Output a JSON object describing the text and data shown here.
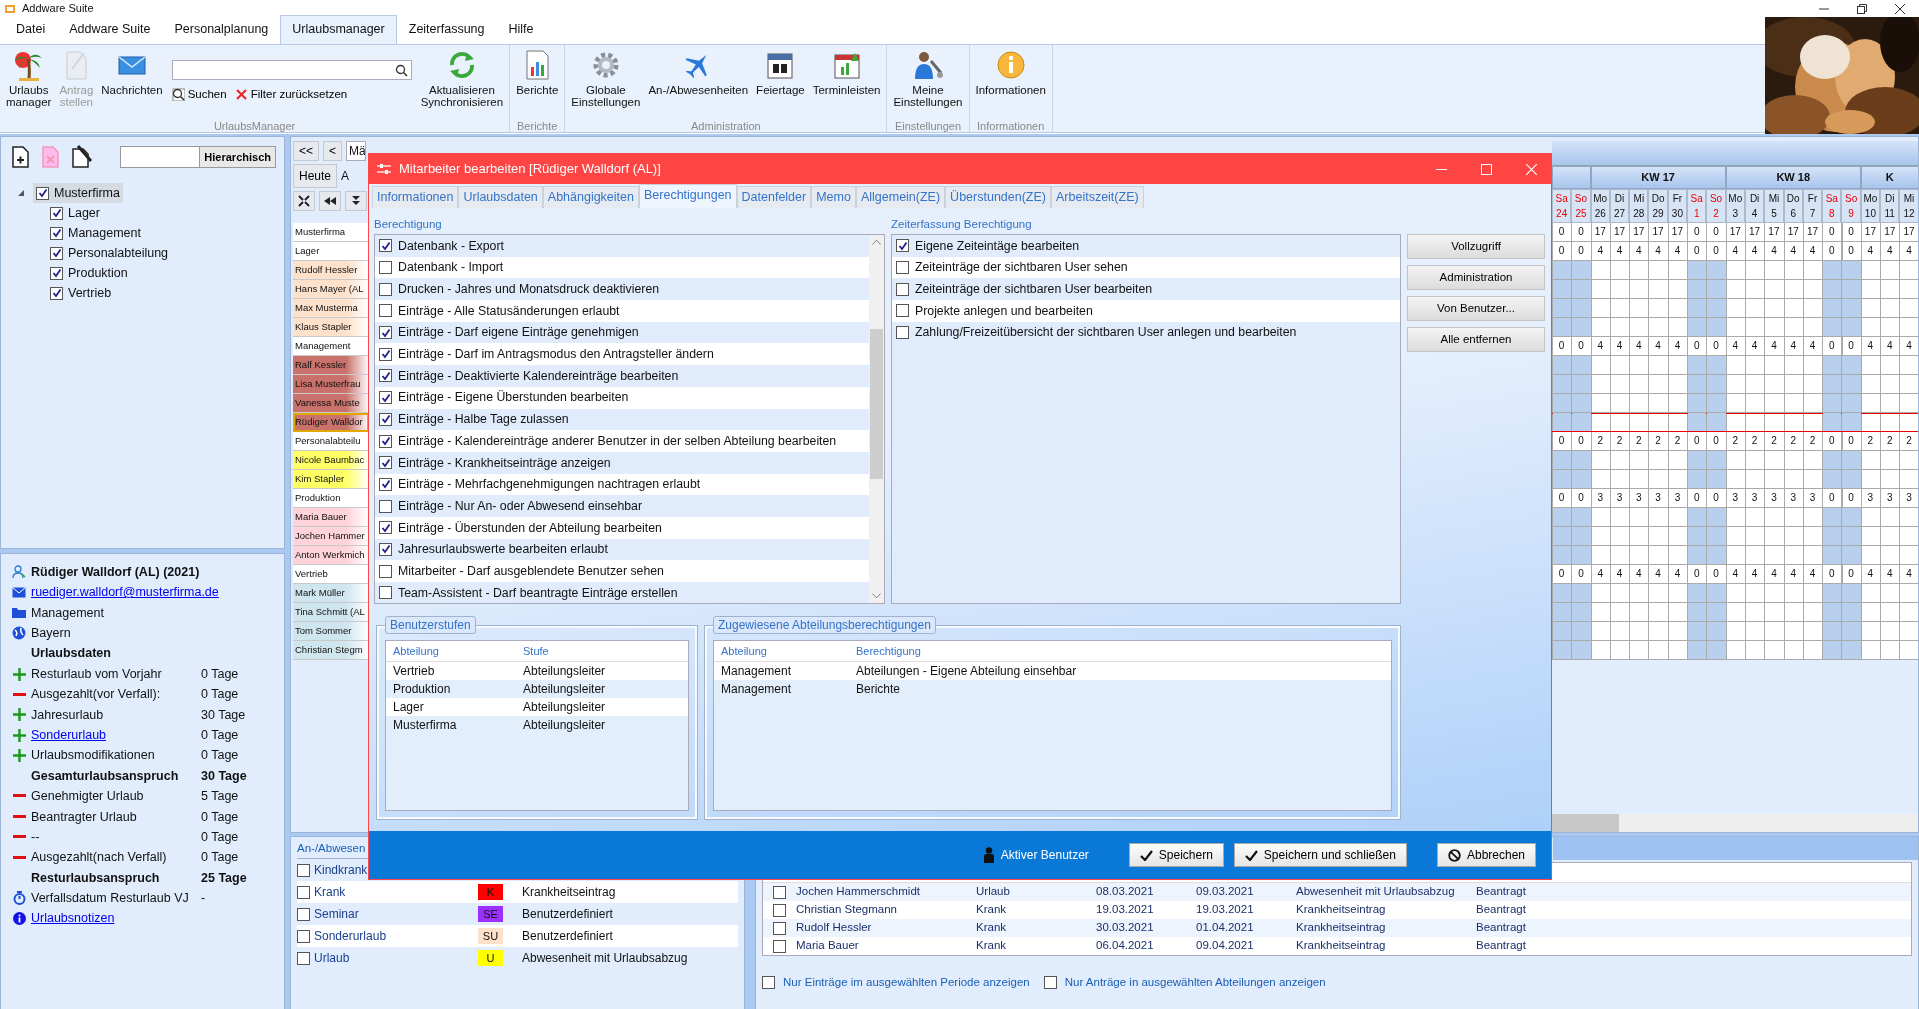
{
  "window": {
    "title": "Addware Suite"
  },
  "menu": [
    {
      "label": "Datei",
      "selected": false
    },
    {
      "label": "Addware Suite",
      "selected": false
    },
    {
      "label": "Personalplanung",
      "selected": false
    },
    {
      "label": "Urlaubsmanager",
      "selected": true
    },
    {
      "label": "Zeiterfassung",
      "selected": false
    },
    {
      "label": "Hilfe",
      "selected": false
    }
  ],
  "ribbon": {
    "groups": [
      {
        "label": "UrlaubsManager",
        "items": [
          {
            "kind": "large",
            "label": "Urlaubs\nmanager",
            "disabled": false
          },
          {
            "kind": "large",
            "label": "Antrag\nstellen",
            "disabled": true
          },
          {
            "kind": "large",
            "label": "Nachrichten",
            "disabled": false
          },
          {
            "kind": "search",
            "buttons": [
              {
                "label": "Suchen"
              },
              {
                "label": "Filter zurücksetzen"
              }
            ]
          },
          {
            "kind": "large",
            "label": "Aktualisieren\nSynchronisieren",
            "disabled": false
          }
        ]
      },
      {
        "label": "Berichte",
        "items": [
          {
            "kind": "large",
            "label": "Berichte",
            "disabled": false
          }
        ]
      },
      {
        "label": "Administration",
        "items": [
          {
            "kind": "large",
            "label": "Globale\nEinstellungen",
            "disabled": false
          },
          {
            "kind": "large",
            "label": "An-/Abwesenheiten",
            "disabled": false
          },
          {
            "kind": "large",
            "label": "Feiertage",
            "disabled": false
          },
          {
            "kind": "large",
            "label": "Terminleisten",
            "disabled": false
          }
        ]
      },
      {
        "label": "Einstellungen",
        "items": [
          {
            "kind": "large",
            "label": "Meine\nEinstellungen",
            "disabled": false
          }
        ]
      },
      {
        "label": "Informationen",
        "items": [
          {
            "kind": "large",
            "label": "Informationen",
            "disabled": false
          }
        ]
      }
    ]
  },
  "tree": {
    "mode_button": "Hierarchisch",
    "items": [
      {
        "label": "Musterfirma",
        "checked": true,
        "selected": true,
        "expanded": true,
        "children": [
          {
            "label": "Lager",
            "checked": true,
            "selected": false
          },
          {
            "label": "Management",
            "checked": true,
            "selected": false
          },
          {
            "label": "Personalabteilung",
            "checked": true,
            "selected": false
          },
          {
            "label": "Produktion",
            "checked": true,
            "selected": false
          },
          {
            "label": "Vertrieb",
            "checked": true,
            "selected": false
          }
        ]
      }
    ]
  },
  "employee": {
    "name": "Rüdiger Walldorf  (AL) (2021)",
    "email": "ruediger.walldorf@musterfirma.de",
    "department": "Management",
    "region": "Bayern",
    "rows": [
      {
        "kind": "heading",
        "label": "Urlaubsdaten",
        "link": false
      },
      {
        "kind": "plus",
        "label": "Resturlaub vom Vorjahr",
        "value": "0 Tage",
        "link": false
      },
      {
        "kind": "minus",
        "label": "Ausgezahlt(vor Verfall):",
        "value": "0 Tage",
        "link": false
      },
      {
        "kind": "plus",
        "label": "Jahresurlaub",
        "value": "30 Tage",
        "link": false
      },
      {
        "kind": "plus",
        "label": "Sonderurlaub",
        "value": "0 Tage",
        "link": true
      },
      {
        "kind": "plus",
        "label": "Urlaubsmodifikationen",
        "value": "0 Tage",
        "link": false
      },
      {
        "kind": "total",
        "label": "Gesamturlaubsanspruch",
        "value": "30 Tage",
        "link": false
      },
      {
        "kind": "minus",
        "label": "Genehmigter Urlaub",
        "value": "5 Tage",
        "link": false
      },
      {
        "kind": "minus",
        "label": "Beantragter Urlaub",
        "value": "0 Tage",
        "link": false
      },
      {
        "kind": "minus",
        "label": "--",
        "value": "0 Tage",
        "link": false
      },
      {
        "kind": "minus",
        "label": "Ausgezahlt(nach Verfall)",
        "value": "0 Tage",
        "link": false
      },
      {
        "kind": "total",
        "label": "Resturlaubsanspruch",
        "value": "25 Tage",
        "link": false
      },
      {
        "kind": "expiry",
        "label": "Verfallsdatum Resturlaub VJ",
        "value": "-",
        "link": false
      },
      {
        "kind": "note",
        "label": "Urlaubsnotizen",
        "link": true
      }
    ]
  },
  "calendar": {
    "toolbar": {
      "first": "<<",
      "prev": "<",
      "month_field": "Mä",
      "today": "Heute",
      "cut_label": "A"
    },
    "weeks": [
      {
        "days": [
          {
            "day": "Sa",
            "date": "24",
            "weekend": true
          },
          {
            "day": "So",
            "date": "25",
            "weekend": true
          }
        ]
      },
      {
        "label": "KW 17",
        "days": [
          {
            "day": "Mo",
            "date": "26",
            "weekend": false
          },
          {
            "day": "Di",
            "date": "27",
            "weekend": false
          },
          {
            "day": "Mi",
            "date": "28",
            "weekend": false
          },
          {
            "day": "Do",
            "date": "29",
            "weekend": false
          },
          {
            "day": "Fr",
            "date": "30",
            "weekend": false
          },
          {
            "day": "Sa",
            "date": "1",
            "weekend": true
          },
          {
            "day": "So",
            "date": "2",
            "weekend": true
          }
        ]
      },
      {
        "label": "KW 18",
        "days": [
          {
            "day": "Mo",
            "date": "3",
            "weekend": false
          },
          {
            "day": "Di",
            "date": "4",
            "weekend": false
          },
          {
            "day": "Mi",
            "date": "5",
            "weekend": false
          },
          {
            "day": "Do",
            "date": "6",
            "weekend": false
          },
          {
            "day": "Fr",
            "date": "7",
            "weekend": false
          },
          {
            "day": "Sa",
            "date": "8",
            "weekend": true
          },
          {
            "day": "So",
            "date": "9",
            "weekend": true
          }
        ]
      },
      {
        "label": "K",
        "days": [
          {
            "day": "Mo",
            "date": "10",
            "weekend": false
          },
          {
            "day": "Di",
            "date": "11",
            "weekend": false
          },
          {
            "day": "Mi",
            "date": "12",
            "weekend": false
          }
        ]
      }
    ],
    "rows": [
      {
        "kind": "department",
        "name": "Musterfirma",
        "values": [
          "0",
          "0",
          "17",
          "17",
          "17",
          "17",
          "17",
          "0",
          "0",
          "17",
          "17",
          "17",
          "17",
          "17",
          "0",
          "0",
          "17",
          "17",
          "17"
        ]
      },
      {
        "kind": "department",
        "name": "Lager",
        "values": [
          "0",
          "0",
          "4",
          "4",
          "4",
          "4",
          "4",
          "0",
          "0",
          "4",
          "4",
          "4",
          "4",
          "4",
          "0",
          "0",
          "4",
          "4",
          "4"
        ]
      },
      {
        "kind": "person",
        "name": "Rudolf Hessler",
        "color": "#fde1cb",
        "selected": false
      },
      {
        "kind": "person",
        "name": "Hans Mayer (AL",
        "color": "#fde1cb",
        "selected": false
      },
      {
        "kind": "person",
        "name": "Max  Musterma",
        "color": "#fde1cb",
        "selected": false
      },
      {
        "kind": "person",
        "name": "Klaus Stapler",
        "color": "#fde1cb",
        "selected": false
      },
      {
        "kind": "department",
        "name": "Management",
        "values": [
          "0",
          "0",
          "4",
          "4",
          "4",
          "4",
          "4",
          "0",
          "0",
          "4",
          "4",
          "4",
          "4",
          "4",
          "0",
          "0",
          "4",
          "4",
          "4"
        ]
      },
      {
        "kind": "person",
        "name": "Ralf Kessler",
        "color": "#c9716b",
        "selected": false
      },
      {
        "kind": "person",
        "name": "Lisa  Musterfrau",
        "color": "#c9716b",
        "selected": false
      },
      {
        "kind": "person",
        "name": "Vanessa  Muste",
        "color": "#c9716b",
        "selected": false
      },
      {
        "kind": "person",
        "name": "Rüdiger Walldor",
        "color": "#c9716b",
        "selected": true
      },
      {
        "kind": "department",
        "name": "Personalabteilu",
        "values": [
          "0",
          "0",
          "2",
          "2",
          "2",
          "2",
          "2",
          "0",
          "0",
          "2",
          "2",
          "2",
          "2",
          "2",
          "0",
          "0",
          "2",
          "2",
          "2"
        ]
      },
      {
        "kind": "person",
        "name": "Nicole Baumbac",
        "color": "#ffff66",
        "selected": false
      },
      {
        "kind": "person",
        "name": "Kim Stapler",
        "color": "#ffff66",
        "selected": false
      },
      {
        "kind": "department",
        "name": "Produktion",
        "values": [
          "0",
          "0",
          "3",
          "3",
          "3",
          "3",
          "3",
          "0",
          "0",
          "3",
          "3",
          "3",
          "3",
          "3",
          "0",
          "0",
          "3",
          "3",
          "3"
        ]
      },
      {
        "kind": "person",
        "name": "Maria Bauer",
        "color": "#ffd3da",
        "selected": false
      },
      {
        "kind": "person",
        "name": "Jochen Hammer",
        "color": "#ffd3da",
        "selected": false
      },
      {
        "kind": "person",
        "name": "Anton Werkmich",
        "color": "#ffd3da",
        "selected": false
      },
      {
        "kind": "department",
        "name": "Vertrieb",
        "values": [
          "0",
          "0",
          "4",
          "4",
          "4",
          "4",
          "4",
          "0",
          "0",
          "4",
          "4",
          "4",
          "4",
          "4",
          "0",
          "0",
          "4",
          "4",
          "4"
        ]
      },
      {
        "kind": "person",
        "name": "Mark Müller",
        "color": "#cfe6ee",
        "selected": false
      },
      {
        "kind": "person",
        "name": "Tina Schmitt (AL",
        "color": "#cfe6ee",
        "selected": false
      },
      {
        "kind": "person",
        "name": "Tom  Sommer",
        "color": "#cfe6ee",
        "selected": false
      },
      {
        "kind": "person",
        "name": "Christian Stegm",
        "color": "#cfe6ee",
        "selected": false
      }
    ]
  },
  "legend": {
    "tab": "An-/Abwesen",
    "items": [
      {
        "label": "Kindkrank",
        "checked": false
      },
      {
        "label": "Krank",
        "code": "K",
        "color": "#ff0000",
        "type": "Krankheitseintrag",
        "checked": false
      },
      {
        "label": "Seminar",
        "code": "SE",
        "color": "#9b30ff",
        "type": "Benutzerdefiniert",
        "checked": false
      },
      {
        "label": "Sonderurlaub",
        "code": "SU",
        "color": "#fde1cb",
        "type": "Benutzerdefiniert",
        "checked": false
      },
      {
        "label": "Urlaub",
        "code": "U",
        "color": "#ffff00",
        "type": "Abwesenheit mit Urlaubsabzug",
        "checked": false
      }
    ]
  },
  "requests": {
    "rows": [
      {
        "checked": false,
        "cells": [
          "Jochen Hammerschmidt",
          "Urlaub",
          "08.03.2021",
          "09.03.2021",
          "Abwesenheit mit Urlaubsabzug",
          "Beantragt"
        ]
      },
      {
        "checked": false,
        "cells": [
          "Christian Stegmann",
          "Krank",
          "19.03.2021",
          "19.03.2021",
          "Krankheitseintrag",
          "Beantragt"
        ]
      },
      {
        "checked": false,
        "cells": [
          "Rudolf Hessler",
          "Krank",
          "30.03.2021",
          "01.04.2021",
          "Krankheitseintrag",
          "Beantragt"
        ]
      },
      {
        "checked": false,
        "cells": [
          "Maria Bauer",
          "Krank",
          "06.04.2021",
          "09.04.2021",
          "Krankheitseintrag",
          "Beantragt"
        ]
      }
    ],
    "filters": [
      {
        "label": "Nur Einträge im ausgewählten Periode anzeigen",
        "checked": false
      },
      {
        "label": "Nur Anträge in ausgewählten Abteilungen anzeigen",
        "checked": false
      }
    ]
  },
  "dialog": {
    "title": "Mitarbeiter bearbeiten [Rüdiger Walldorf  (AL)]",
    "tabs": [
      {
        "label": "Informationen",
        "selected": false
      },
      {
        "label": "Urlaubsdaten",
        "selected": false
      },
      {
        "label": "Abhängigkeiten",
        "selected": false
      },
      {
        "label": "Berechtigungen",
        "selected": true
      },
      {
        "label": "Datenfelder",
        "selected": false
      },
      {
        "label": "Memo",
        "selected": false
      },
      {
        "label": "Allgemein(ZE)",
        "selected": false
      },
      {
        "label": "Überstunden(ZE)",
        "selected": false
      },
      {
        "label": "Arbeitszeit(ZE)",
        "selected": false
      }
    ],
    "permissions": {
      "label": "Berechtigung",
      "items": [
        {
          "label": "Datenbank - Export",
          "checked": true
        },
        {
          "label": "Datenbank - Import",
          "checked": false
        },
        {
          "label": "Drucken - Jahres und Monatsdruck deaktivieren",
          "checked": false
        },
        {
          "label": "Einträge - Alle Statusänderungen erlaubt",
          "checked": false
        },
        {
          "label": "Einträge - Darf eigene Einträge genehmigen",
          "checked": true
        },
        {
          "label": "Einträge - Darf im Antragsmodus den Antragsteller ändern",
          "checked": true
        },
        {
          "label": "Einträge - Deaktivierte Kalendereinträge bearbeiten",
          "checked": true
        },
        {
          "label": "Einträge - Eigene Überstunden bearbeiten",
          "checked": true
        },
        {
          "label": "Einträge - Halbe Tage zulassen",
          "checked": true
        },
        {
          "label": "Einträge - Kalendereinträge anderer Benutzer in der selben Abteilung bearbeiten",
          "checked": true
        },
        {
          "label": "Einträge - Krankheitseinträge anzeigen",
          "checked": true
        },
        {
          "label": "Einträge - Mehrfachgenehmigungen nachtragen erlaubt",
          "checked": true
        },
        {
          "label": "Einträge - Nur An- oder Abwesend einsehbar",
          "checked": false
        },
        {
          "label": "Einträge - Überstunden der Abteilung bearbeiten",
          "checked": true
        },
        {
          "label": "Jahresurlaubswerte bearbeiten erlaubt",
          "checked": true
        },
        {
          "label": "Mitarbeiter - Darf ausgeblendete Benutzer sehen",
          "checked": false
        },
        {
          "label": "Team-Assistent - Darf beantragte Einträge erstellen",
          "checked": false
        }
      ]
    },
    "time_permissions": {
      "label": "Zeiterfassung Berechtigung",
      "items": [
        {
          "label": "Eigene Zeiteintäge bearbeiten",
          "checked": true
        },
        {
          "label": "Zeiteinträge der sichtbaren User sehen",
          "checked": false
        },
        {
          "label": "Zeiteinträge der sichtbaren User bearbeiten",
          "checked": false
        },
        {
          "label": "Projekte anlegen und bearbeiten",
          "checked": false
        },
        {
          "label": "Zahlung/Freizeitübersicht der sichtbaren User anlegen und bearbeiten",
          "checked": false
        }
      ]
    },
    "side_buttons": [
      "Vollzugriff",
      "Administration",
      "Von Benutzer...",
      "Alle entfernen"
    ],
    "user_levels": {
      "title": "Benutzerstufen",
      "columns": [
        "Abteilung",
        "Stufe"
      ],
      "rows": [
        [
          "Vertrieb",
          "Abteilungsleiter"
        ],
        [
          "Produktion",
          "Abteilungsleiter"
        ],
        [
          "Lager",
          "Abteilungsleiter"
        ],
        [
          "Musterfirma",
          "Abteilungsleiter"
        ]
      ]
    },
    "dept_permissions": {
      "title": "Zugewiesene Abteilungsberechtigungen",
      "columns": [
        "Abteilung",
        "Berechtigung"
      ],
      "rows": [
        [
          "Management",
          "Abteilungen - Eigene Abteilung einsehbar"
        ],
        [
          "Management",
          "Berichte"
        ]
      ]
    },
    "footer": {
      "active_user": "Aktiver Benutzer",
      "buttons": [
        {
          "kind": "check",
          "label": "Speichern"
        },
        {
          "kind": "check",
          "label": "Speichern und schließen"
        },
        {
          "kind": "cancel",
          "label": "Abbrechen"
        }
      ]
    }
  }
}
